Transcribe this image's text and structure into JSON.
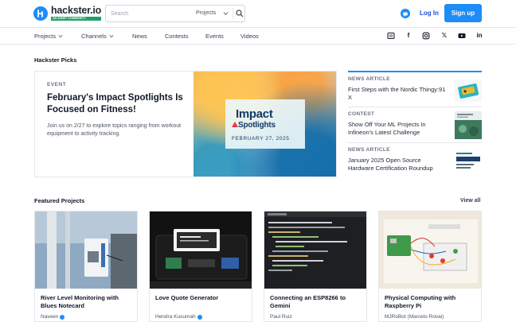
{
  "brand": {
    "name": "hackster.io",
    "badge": "AN AVNET COMMUNITY",
    "accent": "#1d8cf8"
  },
  "search": {
    "placeholder": "Search",
    "scope": "Projects"
  },
  "header": {
    "login_label": "Log In",
    "signup_label": "Sign up"
  },
  "nav": {
    "items": [
      "Projects",
      "Channels",
      "News",
      "Contests",
      "Events",
      "Videos"
    ]
  },
  "social_icons": [
    "rss-icon",
    "facebook-icon",
    "instagram-icon",
    "x-icon",
    "youtube-icon",
    "linkedin-icon"
  ],
  "picks": {
    "section_title": "Hackster Picks",
    "featured": {
      "label": "EVENT",
      "title": "February's Impact Spotlights Is Focused on Fitness!",
      "description": "Join us on 2/27 to explore topics ranging from workout equipment to activity tracking.",
      "image_title": "Impact",
      "image_subtitle": "Spotlights",
      "image_date": "FEBRUARY 27, 2025"
    },
    "news": [
      {
        "category": "NEWS ARTICLE",
        "title": "First Steps with the Nordic Thingy:91 X"
      },
      {
        "category": "CONTEST",
        "title": "Show Off Your ML Projects In Infineon's Latest Challenge"
      },
      {
        "category": "NEWS ARTICLE",
        "title": "January 2025 Open Source Hardware Certification Roundup"
      }
    ]
  },
  "featured": {
    "section_title": "Featured Projects",
    "view_all_label": "View all",
    "projects": [
      {
        "title": "River Level Monitoring with Blues Notecard",
        "author": "Naveen",
        "verified": true
      },
      {
        "title": "Love Quote Generator",
        "author": "Hendra Kusumah",
        "verified": true
      },
      {
        "title": "Connecting an ESP8266 to Gemini",
        "author": "Paul Ruiz",
        "verified": false
      },
      {
        "title": "Physical Computing with Raspberry Pi",
        "author": "MJRoBot (Marcelo Rovai)",
        "verified": false
      }
    ]
  }
}
